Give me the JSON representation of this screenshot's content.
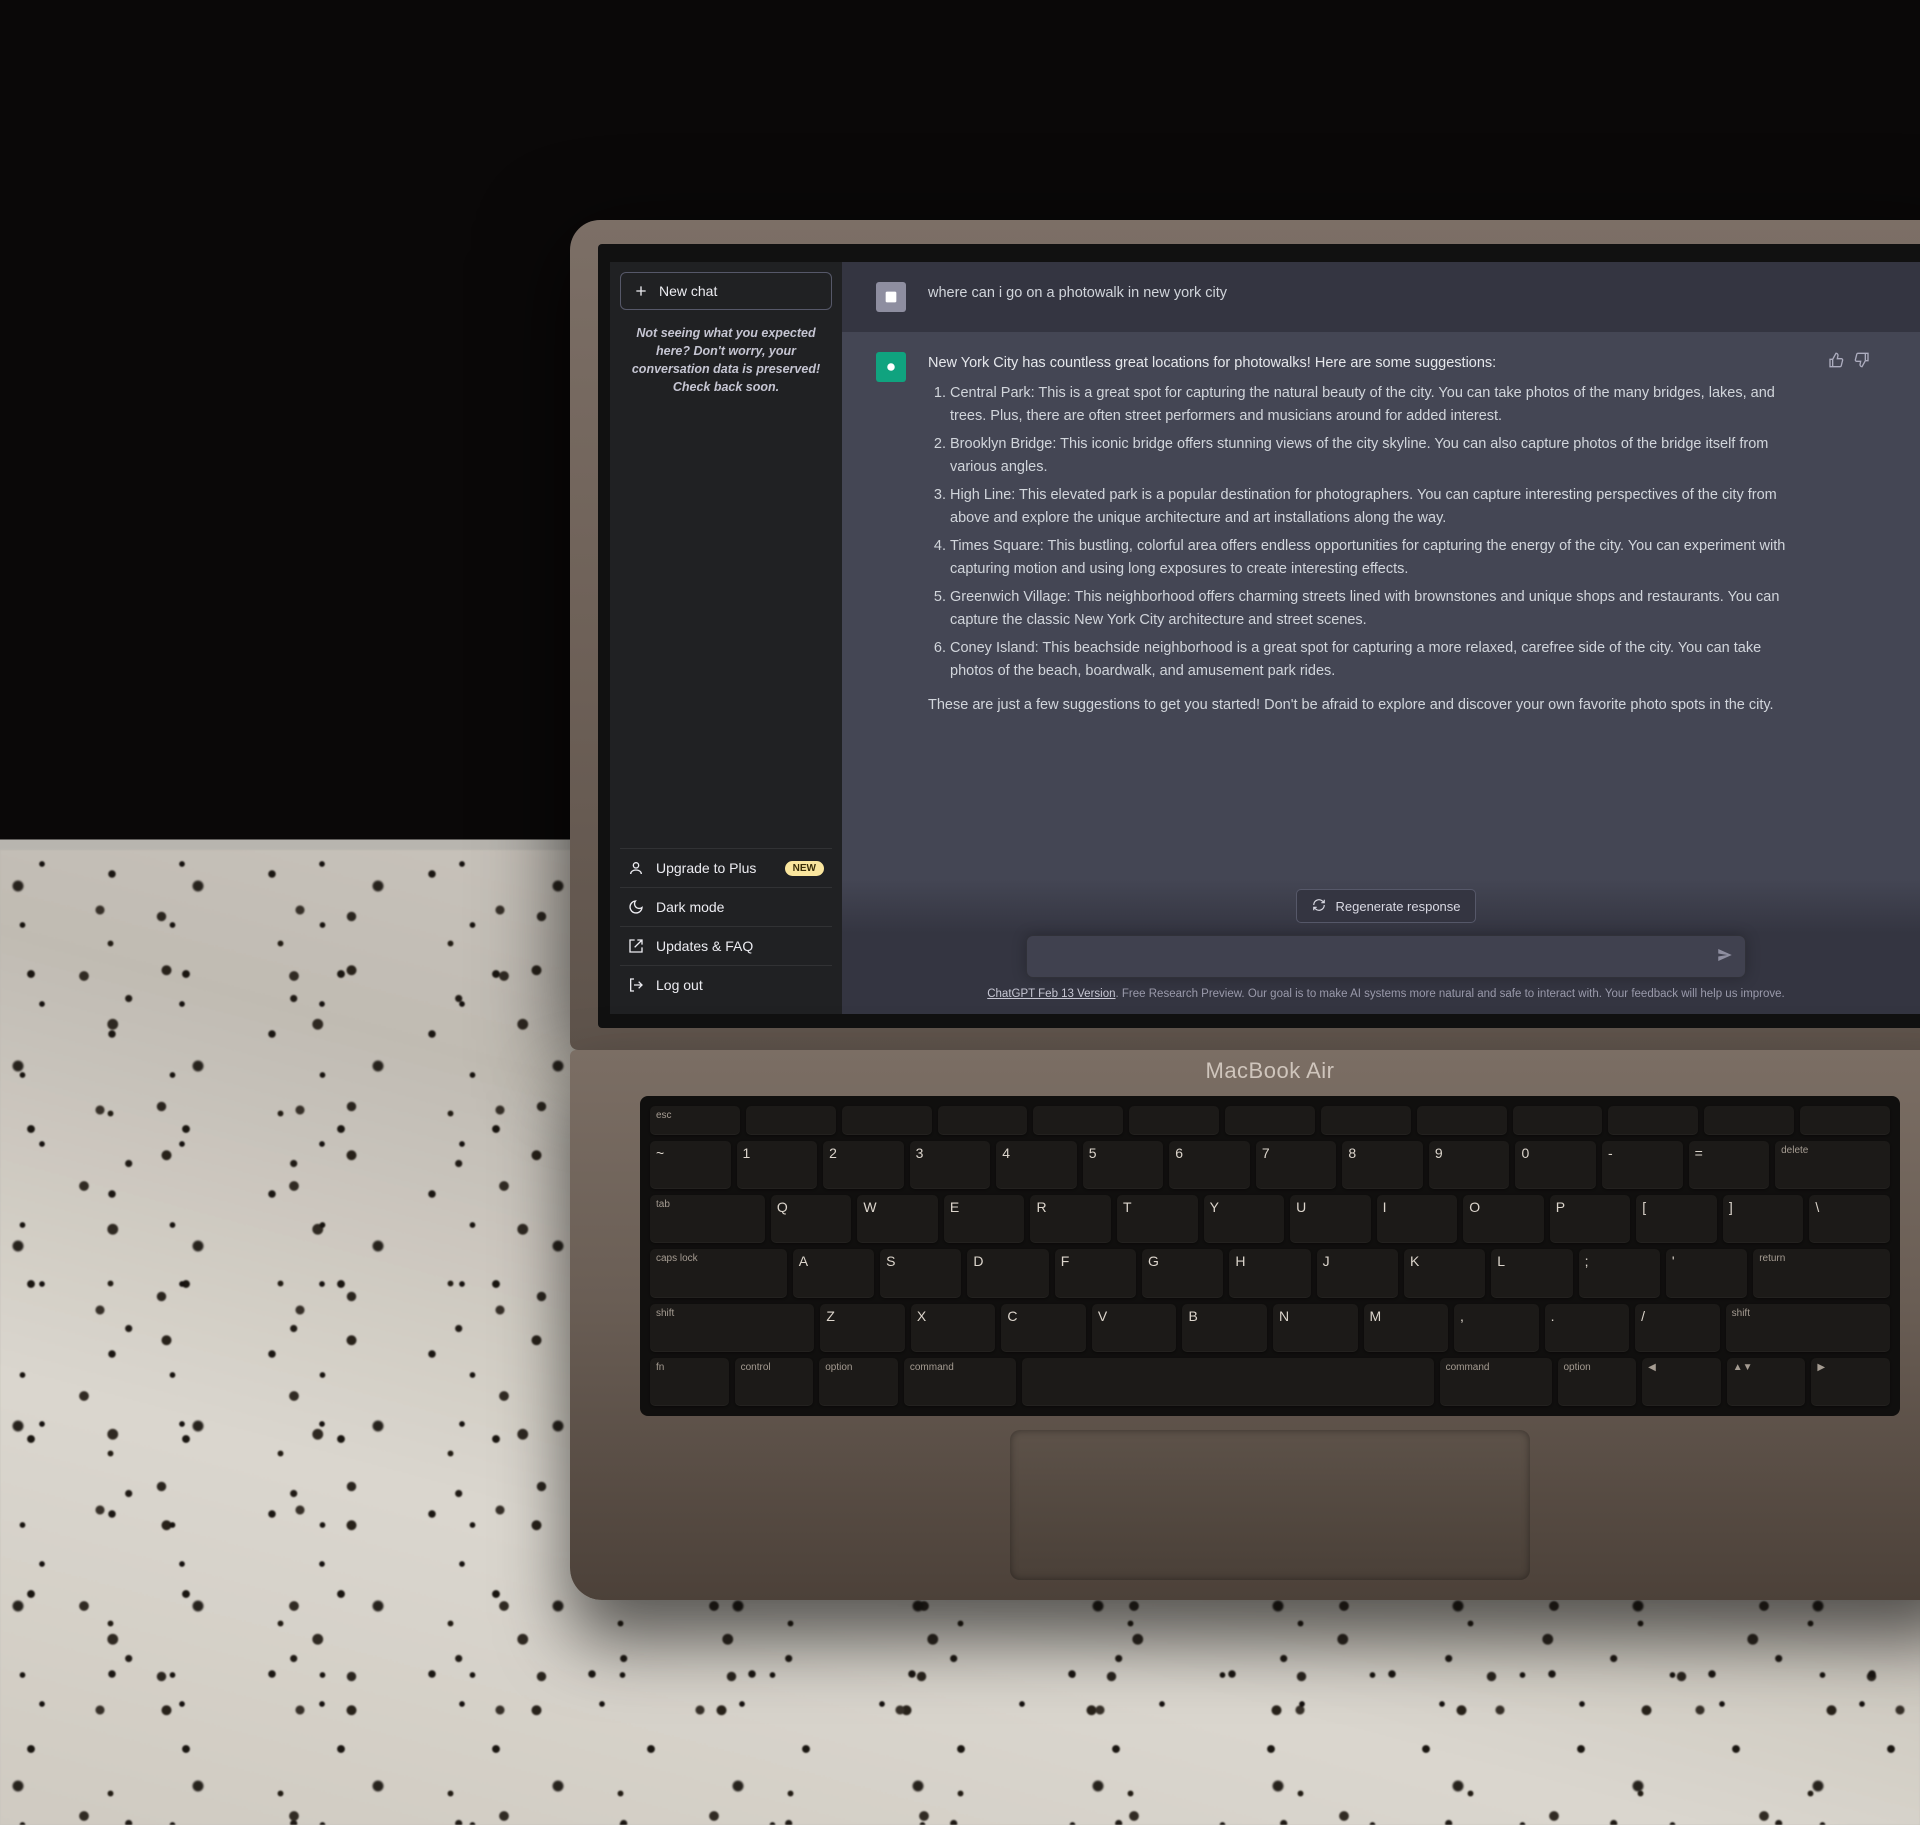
{
  "sidebar": {
    "new_chat": "New chat",
    "notice": "Not seeing what you expected here? Don't worry, your conversation data is preserved! Check back soon.",
    "upgrade": "Upgrade to Plus",
    "upgrade_badge": "NEW",
    "dark_mode": "Dark mode",
    "updates_faq": "Updates & FAQ",
    "log_out": "Log out"
  },
  "chat": {
    "user_message": "where can i go on a photowalk in new york city",
    "assistant_intro": "New York City has countless great locations for photowalks! Here are some suggestions:",
    "items": [
      "Central Park: This is a great spot for capturing the natural beauty of the city. You can take photos of the many bridges, lakes, and trees. Plus, there are often street performers and musicians around for added interest.",
      "Brooklyn Bridge: This iconic bridge offers stunning views of the city skyline. You can also capture photos of the bridge itself from various angles.",
      "High Line: This elevated park is a popular destination for photographers. You can capture interesting perspectives of the city from above and explore the unique architecture and art installations along the way.",
      "Times Square: This bustling, colorful area offers endless opportunities for capturing the energy of the city. You can experiment with capturing motion and using long exposures to create interesting effects.",
      "Greenwich Village: This neighborhood offers charming streets lined with brownstones and unique shops and restaurants. You can capture the classic New York City architecture and street scenes.",
      "Coney Island: This beachside neighborhood is a great spot for capturing a more relaxed, carefree side of the city. You can take photos of the beach, boardwalk, and amusement park rides."
    ],
    "assistant_outro": "These are just a few suggestions to get you started! Don't be afraid to explore and discover your own favorite photo spots in the city."
  },
  "controls": {
    "regenerate": "Regenerate response",
    "footer_link": "ChatGPT Feb 13 Version",
    "footer_rest": ". Free Research Preview. Our goal is to make AI systems more natural and safe to interact with. Your feedback will help us improve."
  },
  "hardware": {
    "model": "MacBook Air"
  }
}
